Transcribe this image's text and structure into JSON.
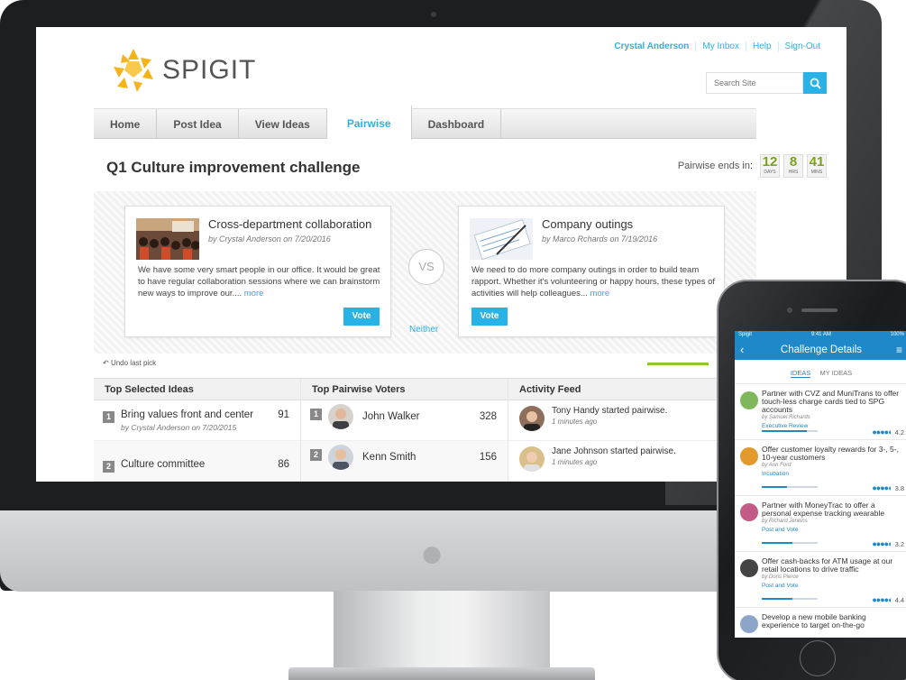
{
  "top_links": [
    "Crystal Anderson",
    "My Inbox",
    "Help",
    "Sign-Out"
  ],
  "brand": "SPIGIT",
  "search_placeholder": "Search Site",
  "nav": [
    "Home",
    "Post Idea",
    "View Ideas",
    "Pairwise",
    "Dashboard"
  ],
  "challenge_title": "Q1 Culture improvement challenge",
  "timer": {
    "label": "Pairwise ends in:",
    "days": "12",
    "days_unit": "DAYS",
    "hrs": "8",
    "hrs_unit": "HRS",
    "mins": "41",
    "mins_unit": "MINS"
  },
  "left_idea": {
    "title": "Cross-department collaboration",
    "byline": "by Crystal Anderson on 7/20/2016",
    "desc": "We have some very smart people in our office. It would be great to have regular collaboration sessions where we can brainstorm new ways to improve our....",
    "more": "more",
    "vote": "Vote"
  },
  "right_idea": {
    "title": "Company outings",
    "byline": "by Marco Rchards on 7/19/2016",
    "desc": "We need to do more company outings in order to build team rapport. Whether it's volunteering or happy hours, these types of activities will help colleagues...",
    "more": "more",
    "vote": "Vote"
  },
  "vs": "VS",
  "neither": "Neither",
  "undo": "Undo last pick",
  "top_selected": {
    "head": "Top Selected Ideas",
    "rows": [
      {
        "rank": "1",
        "title": "Bring values front and center",
        "sub": "by Crystal Anderson on 7/20/2015",
        "score": "91"
      },
      {
        "rank": "2",
        "title": "Culture committee",
        "sub": "",
        "score": "86"
      }
    ]
  },
  "top_voters": {
    "head": "Top Pairwise Voters",
    "rows": [
      {
        "rank": "1",
        "name": "John Walker",
        "score": "328"
      },
      {
        "rank": "2",
        "name": "Kenn Smith",
        "score": "156"
      }
    ]
  },
  "activity": {
    "head": "Activity Feed",
    "rows": [
      {
        "text": "Tony Handy started pairwise.",
        "time": "1 minutes ago"
      },
      {
        "text": "Jane Johnson started pairwise.",
        "time": "1 minutes ago"
      }
    ]
  },
  "phone": {
    "carrier": "Spigit",
    "time": "9:41 AM",
    "battery": "100%",
    "title": "Challenge Details",
    "tab_on": "IDEAS",
    "tab_off": "MY IDEAS",
    "items": [
      {
        "title": "Partner with CVZ and MuniTrans to offer touch-less charge cards tied to SPG accounts",
        "by": "by Samuel Richards",
        "stage": "Executive Review",
        "rating": "4.2",
        "progress": 0.8,
        "pic_color": "#7fb85a"
      },
      {
        "title": "Offer customer loyalty rewards for 3-, 5-, 10-year customers",
        "by": "by Ann Ford",
        "stage": "Incubation",
        "rating": "3.8",
        "progress": 0.45,
        "pic_color": "#e39a2d"
      },
      {
        "title": "Partner with MoneyTrac to offer a personal expense tracking wearable",
        "by": "by Richard Jenkins",
        "stage": "Post and Vote",
        "rating": "3.2",
        "progress": 0.55,
        "pic_color": "#c25b86"
      },
      {
        "title": "Offer cash-backs for ATM usage at our retail locations to drive traffic",
        "by": "by Doris Pierce",
        "stage": "Post and Vote",
        "rating": "4.4",
        "progress": 0.55,
        "pic_color": "#444444"
      },
      {
        "title": "Develop a new mobile banking experience to target on-the-go",
        "by": "",
        "stage": "",
        "rating": "",
        "progress": 0,
        "pic_color": "#8ca6c9"
      }
    ]
  },
  "colors": {
    "accent": "#29b2e6",
    "green": "#8fc91b",
    "phone_blue": "#1e88c9"
  }
}
